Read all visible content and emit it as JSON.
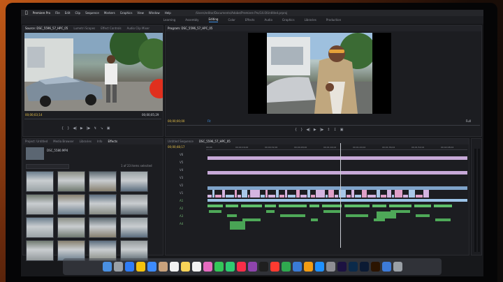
{
  "menubar": {
    "items": [
      "Premiere Pro",
      "File",
      "Edit",
      "Clip",
      "Sequence",
      "Markers",
      "Graphics",
      "View",
      "Window",
      "Help"
    ],
    "document": "/Users/editor/Documents/Adobe/Premiere Pro/14.0/Untitled.prproj"
  },
  "workspaces": [
    "Learning",
    "Assembly",
    "Editing",
    "Color",
    "Effects",
    "Audio",
    "Graphics",
    "Libraries",
    "Production"
  ],
  "workspaces_active": "Editing",
  "source_monitor": {
    "tabs": [
      "Source: DSC_5596_57_HPC_05",
      "Lumetri Scopes",
      "Effect Controls",
      "Audio Clip Mixer"
    ],
    "timecode_in": "00;00;03;14",
    "timecode_out": "00;00;05;29"
  },
  "program_monitor": {
    "tab": "Program: DSC_5596_57_HPC_05",
    "timecode": "00;00;00;00",
    "fit": "Fit",
    "quality": "Full"
  },
  "project_panel": {
    "tabs": [
      "Project: Untitled",
      "Media Browser",
      "Libraries",
      "Info",
      "Effects"
    ],
    "bin": "DSC_5580.MP4",
    "count": "1 of 23 items selected",
    "thumbs": [
      "DSC_5580",
      "DSC_5581",
      "DSC_5582",
      "DSC_5583",
      "DSC_5584",
      "DSC_5585",
      "DSC_5586",
      "DSC_5587",
      "DSC_5588",
      "DSC_5589",
      "DSC_5590",
      "DSC_5591",
      "DSC_5592",
      "DSC_5593",
      "DSC_5594",
      "DSC_5595"
    ]
  },
  "timeline": {
    "tabs": [
      "Untitled Sequence",
      "DSC_5596_57_HPC_05"
    ],
    "timecode": "00;00;48;17",
    "ruler": [
      "00;00",
      "00;00;16;00",
      "00;00;32;00",
      "00;00;48;00",
      "00;01;04;02",
      "00;01;20;02",
      "00;01;36;02",
      "00;01;52;02",
      "00;02;08;04"
    ],
    "track_labels": [
      "V6",
      "V5",
      "V4",
      "V3",
      "V2",
      "V1",
      "A1",
      "A2",
      "A3",
      "A4"
    ]
  },
  "dock": {
    "apps": [
      "Finder",
      "Launchpad",
      "Safari",
      "Chrome",
      "Mail",
      "Contacts",
      "Calendar",
      "Notes",
      "Reminders",
      "Photos",
      "Messages",
      "FaceTime",
      "Music",
      "Podcasts",
      "TV",
      "News",
      "Numbers",
      "Keynote",
      "Pages",
      "App Store",
      "System Preferences",
      "Premiere Pro",
      "Lightroom",
      "Photoshop",
      "Illustrator",
      "Downloads",
      "Trash"
    ]
  }
}
